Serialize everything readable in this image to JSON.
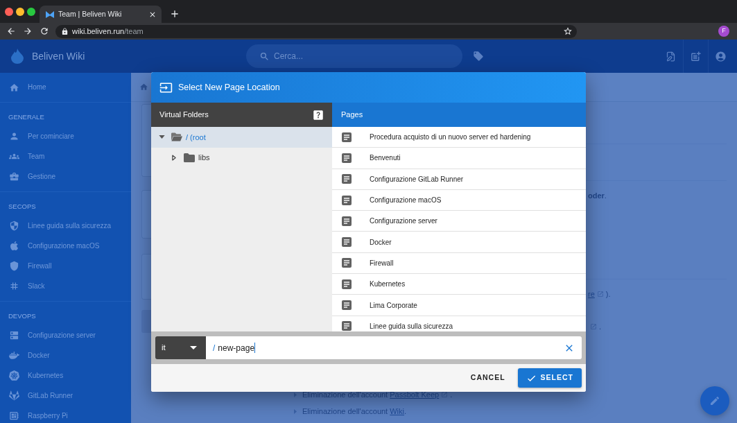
{
  "browser": {
    "tab": {
      "title": "Team | Beliven Wiki",
      "selected": true
    },
    "url": {
      "host": "wiki.beliven.run",
      "path": "/team"
    },
    "profile": "F"
  },
  "header": {
    "title": "Beliven Wiki",
    "search": {
      "placeholder": "Cerca..."
    }
  },
  "sidebar": {
    "sections": [
      {
        "items": [
          {
            "label": "Home"
          }
        ]
      },
      {
        "header": "GENERALE",
        "items": [
          {
            "label": "Per cominciare"
          },
          {
            "label": "Team"
          },
          {
            "label": "Gestione"
          }
        ]
      },
      {
        "header": "SECOPS",
        "items": [
          {
            "label": "Linee guida sulla sicurezza"
          },
          {
            "label": "Configurazione macOS"
          },
          {
            "label": "Firewall"
          },
          {
            "label": "Slack"
          }
        ]
      },
      {
        "header": "DEVOPS",
        "items": [
          {
            "label": "Configurazione server"
          },
          {
            "label": "Docker"
          },
          {
            "label": "Kubernetes"
          },
          {
            "label": "GitLab Runner"
          },
          {
            "label": "Raspberry Pi"
          }
        ]
      }
    ]
  },
  "content": {
    "fragments": [
      {
        "text": "**oder**."
      },
      {
        "link": "re",
        "external": true,
        "text": ")."
      },
      {
        "external": true,
        "text": "."
      }
    ],
    "list": [
      {
        "text": "Eliminazione dell'account",
        "link": "Passbolt Keep",
        "external": true,
        "suffix": "."
      },
      {
        "text": "Eliminazione dell'account",
        "link": "Wiki",
        "external": false,
        "suffix": "."
      }
    ]
  },
  "dialog": {
    "title": "Select New Page Location",
    "folders": {
      "header": "Virtual Folders",
      "tree": [
        {
          "label": "/ (root",
          "expanded": true,
          "selected": true,
          "children": [
            {
              "label": "libs",
              "expanded": false,
              "selected": false
            }
          ]
        }
      ]
    },
    "pages": {
      "header": "Pages",
      "items": [
        {
          "title": "Procedura acquisto di un nuovo server ed hardening"
        },
        {
          "title": "Benvenuti"
        },
        {
          "title": "Configurazione GitLab Runner"
        },
        {
          "title": "Configurazione macOS"
        },
        {
          "title": "Configurazione server"
        },
        {
          "title": "Docker"
        },
        {
          "title": "Firewall"
        },
        {
          "title": "Kubernetes"
        },
        {
          "title": "Lima Corporate"
        },
        {
          "title": "Linee guida sulla sicurezza"
        }
      ]
    },
    "locale": "it",
    "path": {
      "prefix": "/",
      "value": "new-page"
    },
    "actions": [
      {
        "kind": "flat",
        "label": "CANCEL"
      },
      {
        "kind": "primary",
        "label": "SELECT"
      }
    ]
  }
}
